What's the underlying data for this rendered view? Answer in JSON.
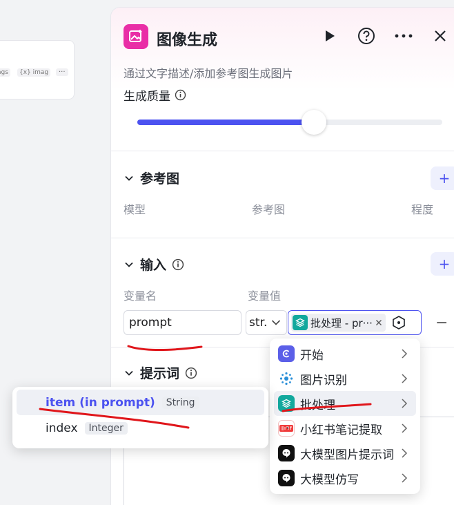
{
  "bg_card": {
    "chip_a": "ags",
    "chip_b": "{x} imag",
    "more": "···"
  },
  "header": {
    "title": "图像生成",
    "description": "通过文字描述/添加参考图生成图片"
  },
  "quality": {
    "label": "生成质量",
    "value_fraction": 0.58
  },
  "reference": {
    "title": "参考图",
    "columns": [
      "模型",
      "参考图",
      "程度"
    ]
  },
  "input": {
    "title": "输入",
    "col_name": "变量名",
    "col_value": "变量值",
    "var_name": "prompt",
    "type_short": "str.",
    "ref_label": "批处理 - pr···"
  },
  "prompt_section": {
    "title": "提示词"
  },
  "menu": {
    "items": [
      {
        "label": "开始",
        "icon": "start-icon",
        "color": "#5b5fe8"
      },
      {
        "label": "图片识别",
        "icon": "image-recognition-icon",
        "color": "#2a8fd8"
      },
      {
        "label": "批处理",
        "icon": "batch-icon",
        "color": "#12a89d"
      },
      {
        "label": "小红书笔记提取",
        "icon": "xiaohongshu-icon",
        "color": "#f03b3b"
      },
      {
        "label": "大模型图片提示词",
        "icon": "llm-image-prompt-icon",
        "color": "#111111"
      },
      {
        "label": "大模型仿写",
        "icon": "llm-rewrite-icon",
        "color": "#111111"
      }
    ]
  },
  "submenu": {
    "items": [
      {
        "name": "item (in prompt)",
        "type": "String"
      },
      {
        "name": "index",
        "type": "Integer"
      }
    ]
  },
  "colors": {
    "accent": "#4c52f0",
    "brand_pink": "#e92ea6",
    "annotation_red": "#e0161b"
  }
}
